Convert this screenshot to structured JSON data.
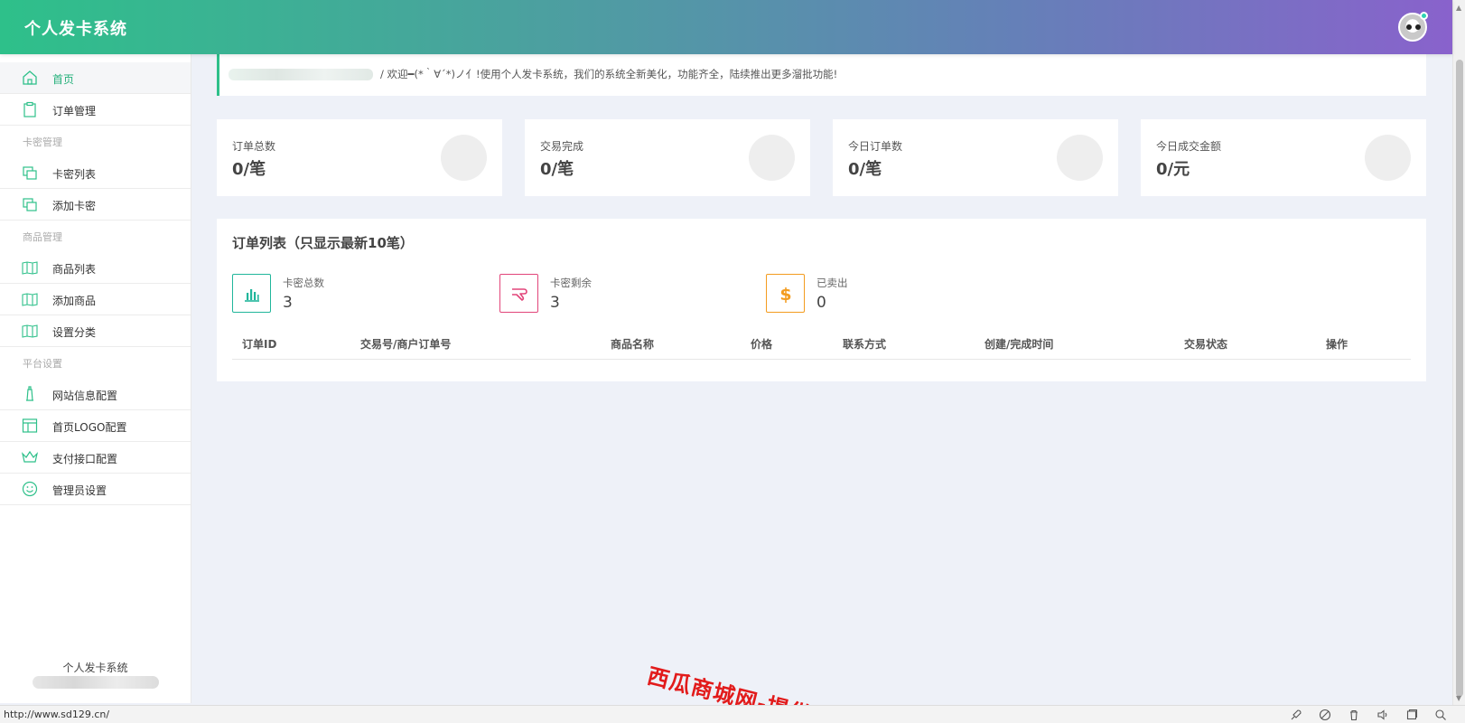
{
  "header": {
    "brand": "个人发卡系统"
  },
  "sidebar": {
    "items": [
      {
        "label": "首页",
        "icon": "home-icon",
        "active": true
      },
      {
        "label": "订单管理",
        "icon": "clipboard-icon"
      },
      {
        "group": "卡密管理"
      },
      {
        "label": "卡密列表",
        "icon": "copy-icon"
      },
      {
        "label": "添加卡密",
        "icon": "copy-icon"
      },
      {
        "group": "商品管理"
      },
      {
        "label": "商品列表",
        "icon": "book-icon"
      },
      {
        "label": "添加商品",
        "icon": "book-icon"
      },
      {
        "label": "设置分类",
        "icon": "book-icon"
      },
      {
        "group": "平台设置"
      },
      {
        "label": "网站信息配置",
        "icon": "lighthouse-icon"
      },
      {
        "label": "首页LOGO配置",
        "icon": "layout-icon"
      },
      {
        "label": "支付接口配置",
        "icon": "crown-icon"
      },
      {
        "label": "管理员设置",
        "icon": "smile-icon"
      }
    ],
    "footer": "个人发卡系统"
  },
  "welcome": {
    "message": "/  欢迎━(*｀∀´*)ノ亻!使用个人发卡系统，我们的系统全新美化，功能齐全，陆续推出更多溜批功能!"
  },
  "stats": [
    {
      "title": "订单总数",
      "value": "0/笔"
    },
    {
      "title": "交易完成",
      "value": "0/笔"
    },
    {
      "title": "今日订单数",
      "value": "0/笔"
    },
    {
      "title": "今日成交金额",
      "value": "0/元"
    }
  ],
  "orders": {
    "title": "订单列表（只显示最新10笔）",
    "summary": [
      {
        "label": "卡密总数",
        "value": "3",
        "icon": "bar-chart-icon",
        "color": "#21b69b"
      },
      {
        "label": "卡密剩余",
        "value": "3",
        "icon": "hand-icon",
        "color": "#e2457a"
      },
      {
        "label": "已卖出",
        "value": "0",
        "icon": "dollar-icon",
        "color": "#f39c1f"
      }
    ],
    "columns": [
      "订单ID",
      "交易号/商户订单号",
      "商品名称",
      "价格",
      "联系方式",
      "创建/完成时间",
      "交易状态",
      "操作"
    ]
  },
  "statusbar": {
    "url": "http://www.sd129.cn/"
  },
  "watermark": "西瓜商城网-提供",
  "colors": {
    "accent": "#24b07a",
    "header_start": "#2ec08a",
    "header_end": "#8962cc"
  }
}
